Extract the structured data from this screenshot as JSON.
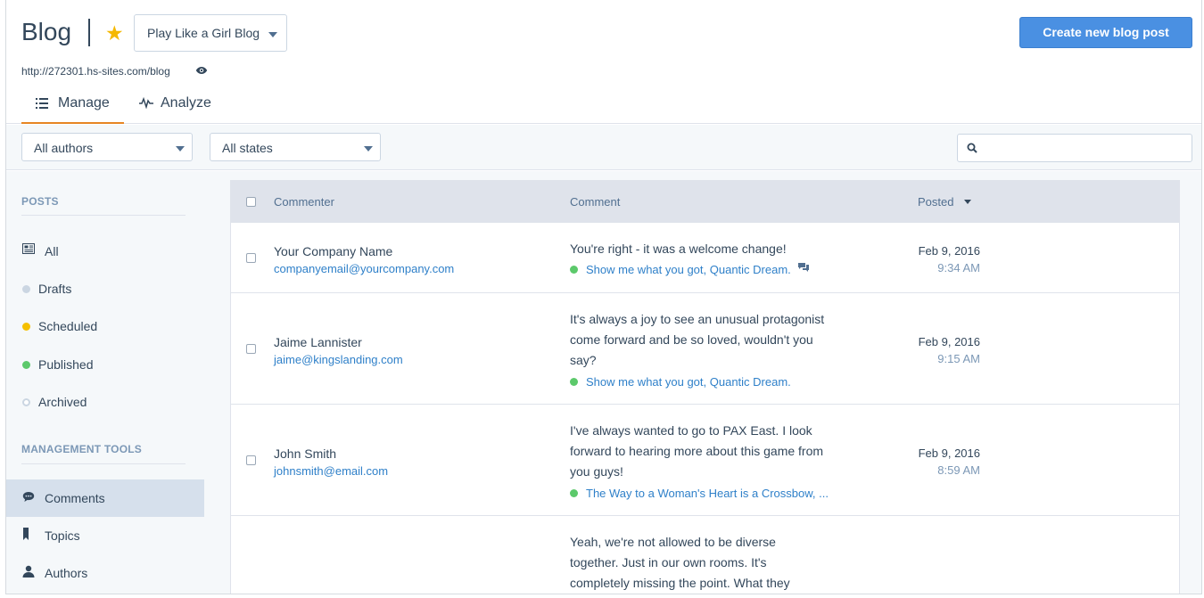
{
  "header": {
    "title": "Blog",
    "blog_selector": "Play Like a Girl Blog",
    "blog_url": "http://272301.hs-sites.com/blog",
    "create_button": "Create new blog post",
    "tabs": [
      {
        "label": "Manage",
        "icon": "list-icon",
        "active": true
      },
      {
        "label": "Analyze",
        "icon": "pulse-icon",
        "active": false
      }
    ]
  },
  "filters": {
    "authors": "All authors",
    "states": "All states",
    "search_placeholder": ""
  },
  "sidebar": {
    "posts_heading": "POSTS",
    "posts": [
      {
        "label": "All",
        "icon": "posts-grid-icon"
      },
      {
        "label": "Drafts",
        "color": "#cbd6e2"
      },
      {
        "label": "Scheduled",
        "color": "#f5c000"
      },
      {
        "label": "Published",
        "color": "#5cc96b"
      },
      {
        "label": "Archived",
        "color": "hollow"
      }
    ],
    "tools_heading": "MANAGEMENT TOOLS",
    "tools": [
      {
        "label": "Comments",
        "icon": "comment-icon",
        "active": true
      },
      {
        "label": "Topics",
        "icon": "bookmark-icon"
      },
      {
        "label": "Authors",
        "icon": "person-icon"
      }
    ]
  },
  "table": {
    "columns": {
      "commenter": "Commenter",
      "comment": "Comment",
      "posted": "Posted"
    },
    "rows": [
      {
        "name": "Your Company Name",
        "email": "companyemail@yourcompany.com",
        "comment_lines": [
          "You're right - it was a welcome change!"
        ],
        "post": "Show me what you got, Quantic Dream.",
        "has_thread": true,
        "date": "Feb 9, 2016",
        "time": "9:34 AM"
      },
      {
        "name": "Jaime Lannister",
        "email": "jaime@kingslanding.com",
        "comment_lines": [
          "It's always a joy to see an unusual protagonist",
          "come forward and be so loved, wouldn't you",
          "say?"
        ],
        "post": "Show me what you got, Quantic Dream.",
        "has_thread": false,
        "date": "Feb 9, 2016",
        "time": "9:15 AM"
      },
      {
        "name": "John Smith",
        "email": "johnsmith@email.com",
        "comment_lines": [
          "I've always wanted to go to PAX East. I look",
          "forward to hearing more about this game from",
          "you guys!"
        ],
        "post": "The Way to a Woman's Heart is a Crossbow, ...",
        "has_thread": false,
        "date": "Feb 9, 2016",
        "time": "8:59 AM"
      },
      {
        "name": "",
        "email": "",
        "comment_lines": [
          "Yeah, we're not allowed to be diverse",
          "together. Just in our own rooms. It's",
          "completely missing the point. What they"
        ],
        "post": "",
        "has_thread": false,
        "date": "",
        "time": ""
      }
    ]
  }
}
